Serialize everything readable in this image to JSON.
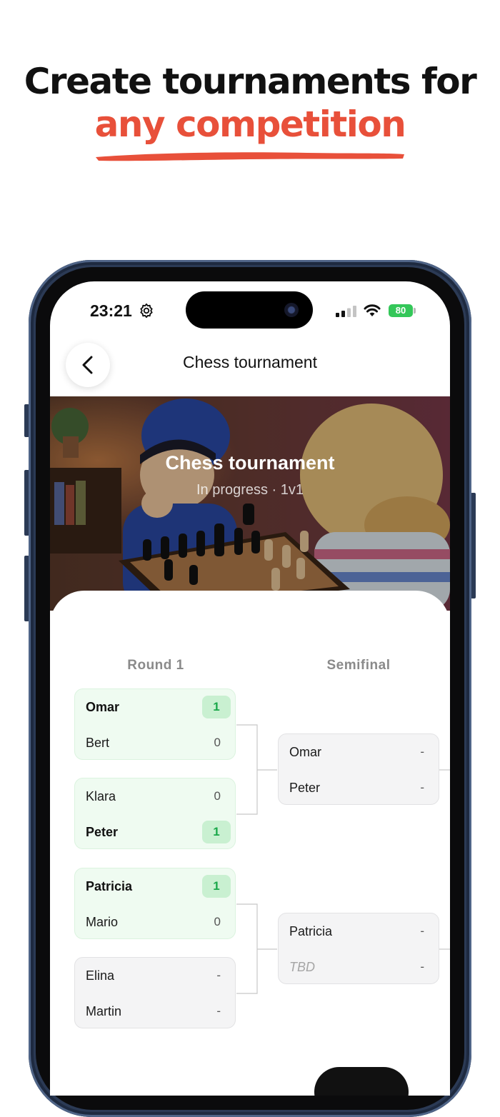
{
  "promo": {
    "headline_line1": "Create tournaments for",
    "headline_line2": "any competition",
    "accent_color": "#e8503a"
  },
  "status_bar": {
    "time": "23:21",
    "battery": "80",
    "icons": [
      "gear-icon",
      "signal-icon",
      "wifi-icon",
      "battery-icon"
    ]
  },
  "nav": {
    "title": "Chess tournament",
    "back_icon": "chevron-left-icon"
  },
  "hero": {
    "title": "Chess tournament",
    "subtitle": "In progress · 1v1"
  },
  "bracket": {
    "rounds": [
      {
        "label": "Round 1",
        "matches": [
          {
            "players": [
              {
                "name": "Omar",
                "score": "1",
                "winner": true
              },
              {
                "name": "Bert",
                "score": "0",
                "winner": false
              }
            ]
          },
          {
            "players": [
              {
                "name": "Klara",
                "score": "0",
                "winner": false
              },
              {
                "name": "Peter",
                "score": "1",
                "winner": true
              }
            ]
          },
          {
            "players": [
              {
                "name": "Patricia",
                "score": "1",
                "winner": true
              },
              {
                "name": "Mario",
                "score": "0",
                "winner": false
              }
            ]
          },
          {
            "players": [
              {
                "name": "Elina",
                "score": "-",
                "winner": false
              },
              {
                "name": "Martin",
                "score": "-",
                "winner": false
              }
            ]
          }
        ]
      },
      {
        "label": "Semifinal",
        "matches": [
          {
            "players": [
              {
                "name": "Omar",
                "score": "-",
                "winner": false
              },
              {
                "name": "Peter",
                "score": "-",
                "winner": false
              }
            ]
          },
          {
            "players": [
              {
                "name": "Patricia",
                "score": "-",
                "winner": false
              },
              {
                "name": "TBD",
                "score": "-",
                "winner": false
              }
            ]
          }
        ]
      }
    ]
  }
}
